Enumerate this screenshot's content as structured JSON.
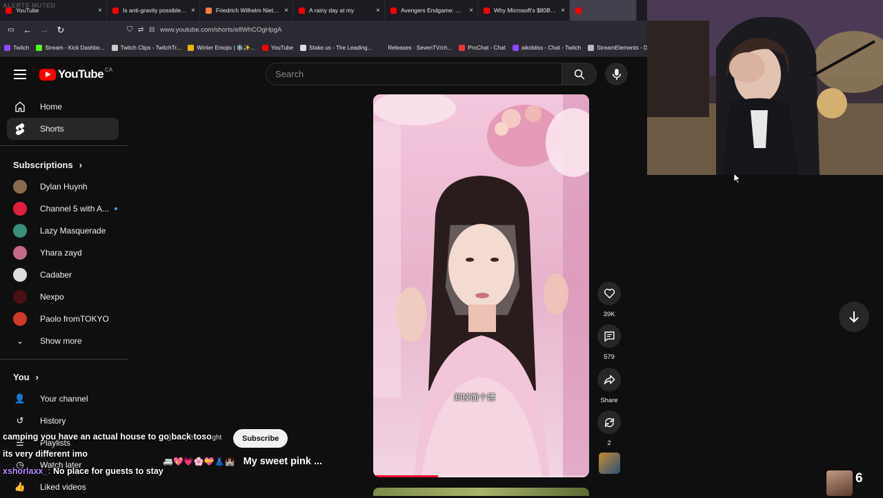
{
  "stream_overlay": {
    "alerts_label": "ALERTS MUTED",
    "viewer_count": "6"
  },
  "tabs": [
    {
      "title": "YouTube",
      "color": "#ff0000",
      "active": false
    },
    {
      "title": "Is anti-gravity possible? - Y",
      "color": "#ff0000",
      "active": false
    },
    {
      "title": "Friedrich Wilhelm Nietzsche",
      "color": "#ff7a3a",
      "active": false
    },
    {
      "title": "A rainy day at my",
      "color": "#ff0000",
      "active": false
    },
    {
      "title": "Avengers Endgame: Encore",
      "color": "#ff0000",
      "active": false
    },
    {
      "title": "Why Microsoft's $80B Xbox",
      "color": "#ff0000",
      "active": false
    },
    {
      "title": "",
      "color": "#ff0000",
      "active": true
    }
  ],
  "address_bar": {
    "url": "www.youtube.com/shorts/e8WhCOgHpgA"
  },
  "bookmarks": [
    {
      "label": "Twitch",
      "color": "#9146ff"
    },
    {
      "label": "Stream - Kick Dashbo...",
      "color": "#53fc18"
    },
    {
      "label": "Twitch Clips - TwitchTr...",
      "color": "#cccccc"
    },
    {
      "label": "Winter Emojis | ❄️✨...",
      "color": "#f0b400"
    },
    {
      "label": "YouTube",
      "color": "#ff0000"
    },
    {
      "label": "Stake.us - The Leading...",
      "color": "#dddddd"
    },
    {
      "label": "Releases · SevenTV/ch...",
      "color": "#2b2a33"
    },
    {
      "label": "ProChat - Chat",
      "color": "#e53935"
    },
    {
      "label": "aikobliss - Chat - Twitch",
      "color": "#9146ff"
    },
    {
      "label": "StreamElements - Das...",
      "color": "#bbbbbb"
    }
  ],
  "youtube": {
    "logo_text": "YouTube",
    "country_code": "CA",
    "search_placeholder": "Search"
  },
  "sidebar": {
    "main": [
      {
        "label": "Home",
        "icon": "home-icon"
      },
      {
        "label": "Shorts",
        "icon": "shorts-icon"
      }
    ],
    "subscriptions_header": "Subscriptions",
    "subscriptions": [
      {
        "name": "Dylan Huynh",
        "color": "#8a6a4e",
        "new": false
      },
      {
        "name": "Channel 5 with A...",
        "color": "#e01f3d",
        "new": true
      },
      {
        "name": "Lazy Masquerade",
        "color": "#3a8f7a",
        "new": false
      },
      {
        "name": "Yhara zayd",
        "color": "#c76a8a",
        "new": false
      },
      {
        "name": "Cadaber",
        "color": "#dddddd",
        "new": false
      },
      {
        "name": "Nexpo",
        "color": "#4a0f12",
        "new": false
      },
      {
        "name": "Paolo fromTOKYO",
        "color": "#d03a2a",
        "new": false
      }
    ],
    "show_more": "Show more",
    "you_header": "You",
    "you_items": [
      {
        "label": "Your channel",
        "icon": "channel-icon"
      },
      {
        "label": "History",
        "icon": "history-icon"
      },
      {
        "label": "Playlists",
        "icon": "playlists-icon"
      },
      {
        "label": "Watch later",
        "icon": "watch-later-icon"
      },
      {
        "label": "Liked videos",
        "icon": "liked-icon"
      }
    ]
  },
  "short": {
    "subtitle": "卸掉面个嫖",
    "channel_handle": "@campermidnight",
    "subscribe_label": "Subscribe",
    "title": "My sweet pink ...",
    "title_emojis": "🚐💖💗🌸💝👗🏰",
    "progress_fraction": 0.3,
    "actions": [
      {
        "name": "like",
        "icon": "heart-icon",
        "label": "39K"
      },
      {
        "name": "comments",
        "icon": "comment-icon",
        "label": "579"
      },
      {
        "name": "share",
        "icon": "share-icon",
        "label": "Share"
      },
      {
        "name": "remix",
        "icon": "remix-icon",
        "label": "2"
      }
    ]
  },
  "chat_overlay": {
    "message1": "camping you have an actual house to go back toso its very different imo",
    "user2": "xshorlaxx_:",
    "message2": "No place for guests to stay"
  }
}
